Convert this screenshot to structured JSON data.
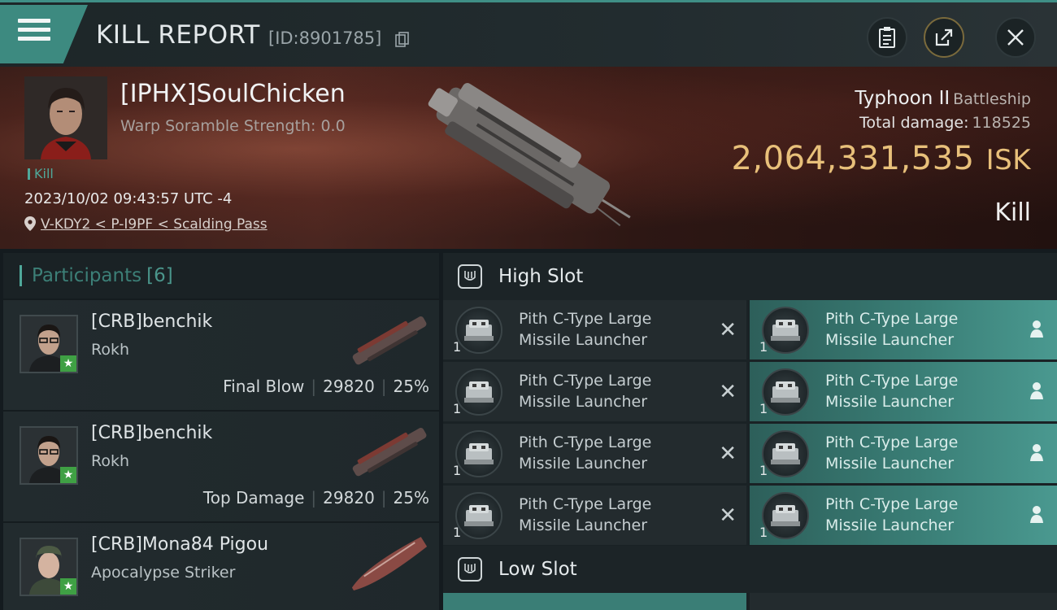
{
  "header": {
    "title": "KILL REPORT",
    "report_id": "[ID:8901785]"
  },
  "victim": {
    "name": "[IPHX]SoulChicken",
    "scramble": "Warp Soramble Strength: 0.0",
    "tag": "Kill",
    "datetime": "2023/10/02 09:43:57 UTC -4",
    "location": "V-KDY2 < P-I9PF < Scalding Pass",
    "ship_name": "Typhoon II",
    "ship_class": "Battleship",
    "total_damage_label": "Total damage:",
    "total_damage": "118525",
    "isk_value": "2,064,331,535",
    "isk_unit": "ISK",
    "result": "Kill"
  },
  "participants": {
    "label": "Participants",
    "count": "[6]",
    "rows": [
      {
        "name": "[CRB]benchik",
        "ship": "Rokh",
        "role": "Final Blow",
        "damage": "29820",
        "percent": "25%"
      },
      {
        "name": "[CRB]benchik",
        "ship": "Rokh",
        "role": "Top Damage",
        "damage": "29820",
        "percent": "25%"
      },
      {
        "name": "[CRB]Mona84 Pigou",
        "ship": "Apocalypse Striker",
        "role": "",
        "damage": "",
        "percent": ""
      }
    ]
  },
  "slots": {
    "high_label": "High Slot",
    "low_label": "Low Slot",
    "high_modules": [
      {
        "line1": "Pith C-Type Large",
        "line2": "Missile Launcher",
        "qty": "1",
        "state": "destroyed"
      },
      {
        "line1": "Pith C-Type Large",
        "line2": "Missile Launcher",
        "qty": "1",
        "state": "dropped"
      },
      {
        "line1": "Pith C-Type Large",
        "line2": "Missile Launcher",
        "qty": "1",
        "state": "destroyed"
      },
      {
        "line1": "Pith C-Type Large",
        "line2": "Missile Launcher",
        "qty": "1",
        "state": "dropped"
      },
      {
        "line1": "Pith C-Type Large",
        "line2": "Missile Launcher",
        "qty": "1",
        "state": "destroyed"
      },
      {
        "line1": "Pith C-Type Large",
        "line2": "Missile Launcher",
        "qty": "1",
        "state": "dropped"
      },
      {
        "line1": "Pith C-Type Large",
        "line2": "Missile Launcher",
        "qty": "1",
        "state": "destroyed"
      },
      {
        "line1": "Pith C-Type Large",
        "line2": "Missile Launcher",
        "qty": "1",
        "state": "dropped"
      }
    ]
  },
  "icons": {
    "menu": "hamburger-icon",
    "copy": "copy-icon",
    "clipboard": "clipboard-icon",
    "share": "share-icon",
    "close": "close-icon",
    "location": "location-pin-icon"
  },
  "colors": {
    "accent_teal": "#3d8a80",
    "isk_gold": "#e8c07a",
    "star_green": "#3fa044"
  }
}
